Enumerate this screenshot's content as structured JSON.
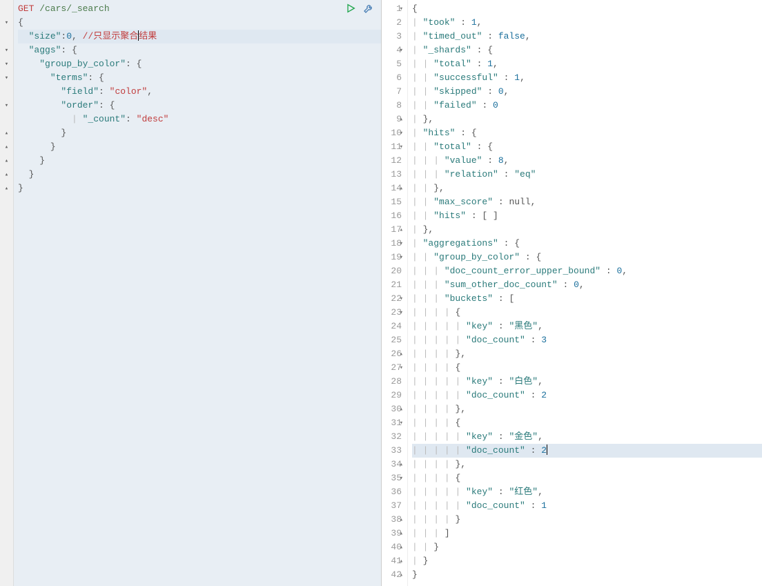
{
  "left": {
    "method": "GET",
    "path": "/cars/_search",
    "comment": "//只显示聚合结果",
    "lines": [
      {
        "indent": 0,
        "tokens": [
          {
            "t": "method",
            "v": "GET"
          },
          {
            "t": "space",
            "v": " "
          },
          {
            "t": "path",
            "v": "/cars/_search"
          }
        ],
        "fold": "",
        "hl": true
      },
      {
        "indent": 0,
        "tokens": [
          {
            "t": "punct",
            "v": "{"
          }
        ],
        "fold": "open",
        "hl": true
      },
      {
        "indent": 1,
        "tokens": [
          {
            "t": "key",
            "v": "\"size\""
          },
          {
            "t": "punct",
            "v": ":"
          },
          {
            "t": "num",
            "v": "0"
          },
          {
            "t": "punct",
            "v": ", "
          },
          {
            "t": "comment",
            "v": "//只显示聚合"
          },
          {
            "t": "cursor",
            "v": ""
          },
          {
            "t": "comment",
            "v": "结果"
          }
        ],
        "fold": "",
        "hl": true,
        "active": true
      },
      {
        "indent": 1,
        "tokens": [
          {
            "t": "key",
            "v": "\"aggs\""
          },
          {
            "t": "punct",
            "v": ": {"
          }
        ],
        "fold": "open",
        "hl": true
      },
      {
        "indent": 2,
        "tokens": [
          {
            "t": "key",
            "v": "\"group_by_color\""
          },
          {
            "t": "punct",
            "v": ": {"
          }
        ],
        "fold": "open",
        "hl": true
      },
      {
        "indent": 3,
        "tokens": [
          {
            "t": "key",
            "v": "\"terms\""
          },
          {
            "t": "punct",
            "v": ": {"
          }
        ],
        "fold": "open",
        "hl": true
      },
      {
        "indent": 4,
        "tokens": [
          {
            "t": "key",
            "v": "\"field\""
          },
          {
            "t": "punct",
            "v": ": "
          },
          {
            "t": "string",
            "v": "\"color\""
          },
          {
            "t": "punct",
            "v": ","
          }
        ],
        "fold": "",
        "hl": true
      },
      {
        "indent": 4,
        "tokens": [
          {
            "t": "key",
            "v": "\"order\""
          },
          {
            "t": "punct",
            "v": ": {"
          }
        ],
        "fold": "open",
        "hl": true
      },
      {
        "indent": 5,
        "tokens": [
          {
            "t": "guide",
            "v": "| "
          },
          {
            "t": "key",
            "v": "\"_count\""
          },
          {
            "t": "punct",
            "v": ": "
          },
          {
            "t": "string",
            "v": "\"desc\""
          }
        ],
        "fold": "",
        "hl": true
      },
      {
        "indent": 4,
        "tokens": [
          {
            "t": "punct",
            "v": "}"
          }
        ],
        "fold": "close",
        "hl": true
      },
      {
        "indent": 3,
        "tokens": [
          {
            "t": "punct",
            "v": "}"
          }
        ],
        "fold": "close",
        "hl": true
      },
      {
        "indent": 2,
        "tokens": [
          {
            "t": "punct",
            "v": "}"
          }
        ],
        "fold": "close",
        "hl": true
      },
      {
        "indent": 1,
        "tokens": [
          {
            "t": "punct",
            "v": "}"
          }
        ],
        "fold": "close",
        "hl": true
      },
      {
        "indent": 0,
        "tokens": [
          {
            "t": "punct",
            "v": "}"
          }
        ],
        "fold": "close",
        "hl": true
      }
    ]
  },
  "right": {
    "lines": [
      {
        "n": 1,
        "indent": 0,
        "tokens": [
          {
            "t": "punct",
            "v": "{"
          }
        ],
        "fold": "open"
      },
      {
        "n": 2,
        "indent": 1,
        "tokens": [
          {
            "t": "key",
            "v": "\"took\""
          },
          {
            "t": "punct",
            "v": " : "
          },
          {
            "t": "num",
            "v": "1"
          },
          {
            "t": "punct",
            "v": ","
          }
        ]
      },
      {
        "n": 3,
        "indent": 1,
        "tokens": [
          {
            "t": "key",
            "v": "\"timed_out\""
          },
          {
            "t": "punct",
            "v": " : "
          },
          {
            "t": "keyword",
            "v": "false"
          },
          {
            "t": "punct",
            "v": ","
          }
        ]
      },
      {
        "n": 4,
        "indent": 1,
        "tokens": [
          {
            "t": "key",
            "v": "\"_shards\""
          },
          {
            "t": "punct",
            "v": " : {"
          }
        ],
        "fold": "open"
      },
      {
        "n": 5,
        "indent": 2,
        "tokens": [
          {
            "t": "key",
            "v": "\"total\""
          },
          {
            "t": "punct",
            "v": " : "
          },
          {
            "t": "num",
            "v": "1"
          },
          {
            "t": "punct",
            "v": ","
          }
        ]
      },
      {
        "n": 6,
        "indent": 2,
        "tokens": [
          {
            "t": "key",
            "v": "\"successful\""
          },
          {
            "t": "punct",
            "v": " : "
          },
          {
            "t": "num",
            "v": "1"
          },
          {
            "t": "punct",
            "v": ","
          }
        ]
      },
      {
        "n": 7,
        "indent": 2,
        "tokens": [
          {
            "t": "key",
            "v": "\"skipped\""
          },
          {
            "t": "punct",
            "v": " : "
          },
          {
            "t": "num",
            "v": "0"
          },
          {
            "t": "punct",
            "v": ","
          }
        ]
      },
      {
        "n": 8,
        "indent": 2,
        "tokens": [
          {
            "t": "key",
            "v": "\"failed\""
          },
          {
            "t": "punct",
            "v": " : "
          },
          {
            "t": "num",
            "v": "0"
          }
        ]
      },
      {
        "n": 9,
        "indent": 1,
        "tokens": [
          {
            "t": "punct",
            "v": "},"
          }
        ],
        "fold": "close"
      },
      {
        "n": 10,
        "indent": 1,
        "tokens": [
          {
            "t": "key",
            "v": "\"hits\""
          },
          {
            "t": "punct",
            "v": " : {"
          }
        ],
        "fold": "open"
      },
      {
        "n": 11,
        "indent": 2,
        "tokens": [
          {
            "t": "key",
            "v": "\"total\""
          },
          {
            "t": "punct",
            "v": " : {"
          }
        ],
        "fold": "open"
      },
      {
        "n": 12,
        "indent": 3,
        "tokens": [
          {
            "t": "key",
            "v": "\"value\""
          },
          {
            "t": "punct",
            "v": " : "
          },
          {
            "t": "num",
            "v": "8"
          },
          {
            "t": "punct",
            "v": ","
          }
        ]
      },
      {
        "n": 13,
        "indent": 3,
        "tokens": [
          {
            "t": "key",
            "v": "\"relation\""
          },
          {
            "t": "punct",
            "v": " : "
          },
          {
            "t": "value",
            "v": "\"eq\""
          }
        ]
      },
      {
        "n": 14,
        "indent": 2,
        "tokens": [
          {
            "t": "punct",
            "v": "},"
          }
        ],
        "fold": "close"
      },
      {
        "n": 15,
        "indent": 2,
        "tokens": [
          {
            "t": "key",
            "v": "\"max_score\""
          },
          {
            "t": "punct",
            "v": " : "
          },
          {
            "t": "null",
            "v": "null"
          },
          {
            "t": "punct",
            "v": ","
          }
        ]
      },
      {
        "n": 16,
        "indent": 2,
        "tokens": [
          {
            "t": "key",
            "v": "\"hits\""
          },
          {
            "t": "punct",
            "v": " : [ ]"
          }
        ]
      },
      {
        "n": 17,
        "indent": 1,
        "tokens": [
          {
            "t": "punct",
            "v": "},"
          }
        ],
        "fold": "close"
      },
      {
        "n": 18,
        "indent": 1,
        "tokens": [
          {
            "t": "key",
            "v": "\"aggregations\""
          },
          {
            "t": "punct",
            "v": " : {"
          }
        ],
        "fold": "open"
      },
      {
        "n": 19,
        "indent": 2,
        "tokens": [
          {
            "t": "key",
            "v": "\"group_by_color\""
          },
          {
            "t": "punct",
            "v": " : {"
          }
        ],
        "fold": "open"
      },
      {
        "n": 20,
        "indent": 3,
        "tokens": [
          {
            "t": "key",
            "v": "\"doc_count_error_upper_bound\""
          },
          {
            "t": "punct",
            "v": " : "
          },
          {
            "t": "num",
            "v": "0"
          },
          {
            "t": "punct",
            "v": ","
          }
        ]
      },
      {
        "n": 21,
        "indent": 3,
        "tokens": [
          {
            "t": "key",
            "v": "\"sum_other_doc_count\""
          },
          {
            "t": "punct",
            "v": " : "
          },
          {
            "t": "num",
            "v": "0"
          },
          {
            "t": "punct",
            "v": ","
          }
        ]
      },
      {
        "n": 22,
        "indent": 3,
        "tokens": [
          {
            "t": "key",
            "v": "\"buckets\""
          },
          {
            "t": "punct",
            "v": " : ["
          }
        ],
        "fold": "open"
      },
      {
        "n": 23,
        "indent": 4,
        "tokens": [
          {
            "t": "punct",
            "v": "{"
          }
        ],
        "fold": "open"
      },
      {
        "n": 24,
        "indent": 5,
        "tokens": [
          {
            "t": "key",
            "v": "\"key\""
          },
          {
            "t": "punct",
            "v": " : "
          },
          {
            "t": "value",
            "v": "\"黑色\""
          },
          {
            "t": "punct",
            "v": ","
          }
        ]
      },
      {
        "n": 25,
        "indent": 5,
        "tokens": [
          {
            "t": "key",
            "v": "\"doc_count\""
          },
          {
            "t": "punct",
            "v": " : "
          },
          {
            "t": "num",
            "v": "3"
          }
        ]
      },
      {
        "n": 26,
        "indent": 4,
        "tokens": [
          {
            "t": "punct",
            "v": "},"
          }
        ],
        "fold": "close"
      },
      {
        "n": 27,
        "indent": 4,
        "tokens": [
          {
            "t": "punct",
            "v": "{"
          }
        ],
        "fold": "open"
      },
      {
        "n": 28,
        "indent": 5,
        "tokens": [
          {
            "t": "key",
            "v": "\"key\""
          },
          {
            "t": "punct",
            "v": " : "
          },
          {
            "t": "value",
            "v": "\"白色\""
          },
          {
            "t": "punct",
            "v": ","
          }
        ]
      },
      {
        "n": 29,
        "indent": 5,
        "tokens": [
          {
            "t": "key",
            "v": "\"doc_count\""
          },
          {
            "t": "punct",
            "v": " : "
          },
          {
            "t": "num",
            "v": "2"
          }
        ]
      },
      {
        "n": 30,
        "indent": 4,
        "tokens": [
          {
            "t": "punct",
            "v": "},"
          }
        ],
        "fold": "close"
      },
      {
        "n": 31,
        "indent": 4,
        "tokens": [
          {
            "t": "punct",
            "v": "{"
          }
        ],
        "fold": "open"
      },
      {
        "n": 32,
        "indent": 5,
        "tokens": [
          {
            "t": "key",
            "v": "\"key\""
          },
          {
            "t": "punct",
            "v": " : "
          },
          {
            "t": "value",
            "v": "\"金色\""
          },
          {
            "t": "punct",
            "v": ","
          }
        ]
      },
      {
        "n": 33,
        "indent": 5,
        "tokens": [
          {
            "t": "key",
            "v": "\"doc_count\""
          },
          {
            "t": "punct",
            "v": " : "
          },
          {
            "t": "num",
            "v": "2"
          },
          {
            "t": "cursor",
            "v": ""
          }
        ],
        "active": true
      },
      {
        "n": 34,
        "indent": 4,
        "tokens": [
          {
            "t": "punct",
            "v": "},"
          }
        ],
        "fold": "close"
      },
      {
        "n": 35,
        "indent": 4,
        "tokens": [
          {
            "t": "punct",
            "v": "{"
          }
        ],
        "fold": "open"
      },
      {
        "n": 36,
        "indent": 5,
        "tokens": [
          {
            "t": "key",
            "v": "\"key\""
          },
          {
            "t": "punct",
            "v": " : "
          },
          {
            "t": "value",
            "v": "\"红色\""
          },
          {
            "t": "punct",
            "v": ","
          }
        ]
      },
      {
        "n": 37,
        "indent": 5,
        "tokens": [
          {
            "t": "key",
            "v": "\"doc_count\""
          },
          {
            "t": "punct",
            "v": " : "
          },
          {
            "t": "num",
            "v": "1"
          }
        ]
      },
      {
        "n": 38,
        "indent": 4,
        "tokens": [
          {
            "t": "punct",
            "v": "}"
          }
        ],
        "fold": "close"
      },
      {
        "n": 39,
        "indent": 3,
        "tokens": [
          {
            "t": "punct",
            "v": "]"
          }
        ],
        "fold": "close"
      },
      {
        "n": 40,
        "indent": 2,
        "tokens": [
          {
            "t": "punct",
            "v": "}"
          }
        ],
        "fold": "close"
      },
      {
        "n": 41,
        "indent": 1,
        "tokens": [
          {
            "t": "punct",
            "v": "}"
          }
        ],
        "fold": "close"
      },
      {
        "n": 42,
        "indent": 0,
        "tokens": [
          {
            "t": "punct",
            "v": "}"
          }
        ],
        "fold": "close"
      }
    ]
  },
  "icons": {
    "play": "play-icon",
    "wrench": "wrench-icon"
  }
}
